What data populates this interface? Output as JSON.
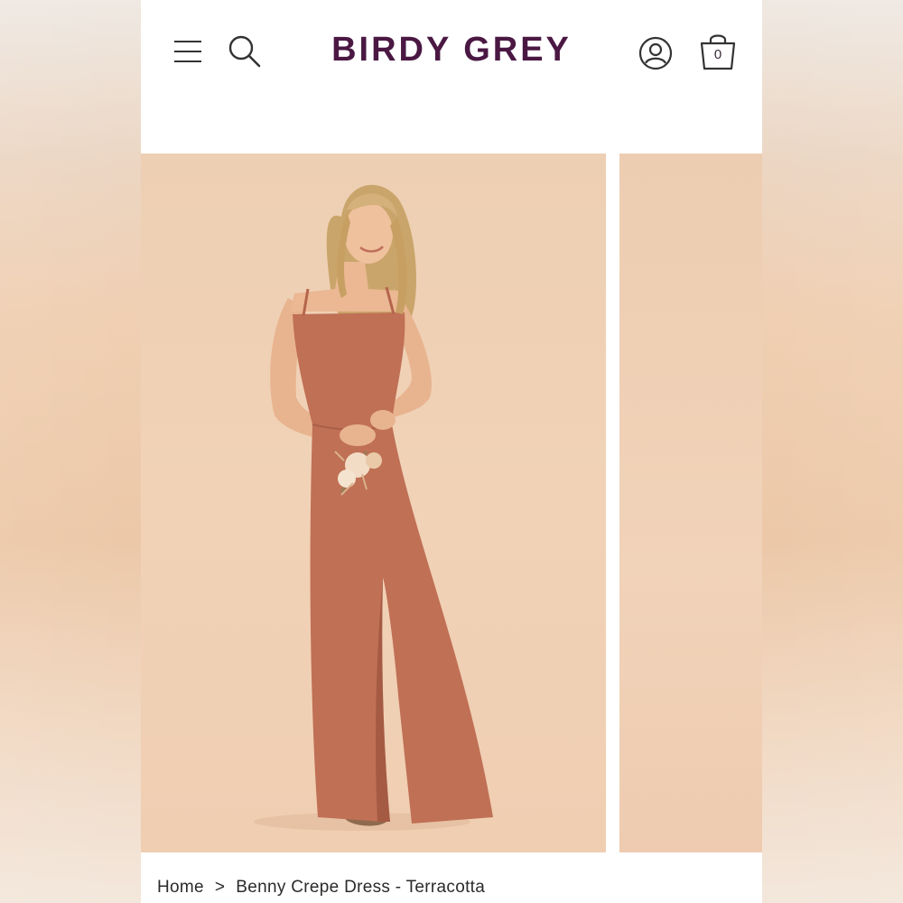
{
  "brand": {
    "logo_text": "BIRDY GREY",
    "logo_color": "#4a1843"
  },
  "header": {
    "menu_icon": "hamburger-menu-icon",
    "search_icon": "search-icon",
    "account_icon": "user-account-icon",
    "bag_icon": "shopping-bag-icon",
    "bag_count": "0"
  },
  "gallery": {
    "images": [
      {
        "name": "model-in-terracotta-dress",
        "active": true
      },
      {
        "name": "next-product-image",
        "active": false
      }
    ]
  },
  "breadcrumb": {
    "home": "Home",
    "separator": ">",
    "current": "Benny Crepe Dress - Terracotta"
  },
  "colors": {
    "dress": "#c07055",
    "background": "#f0cfb3"
  }
}
